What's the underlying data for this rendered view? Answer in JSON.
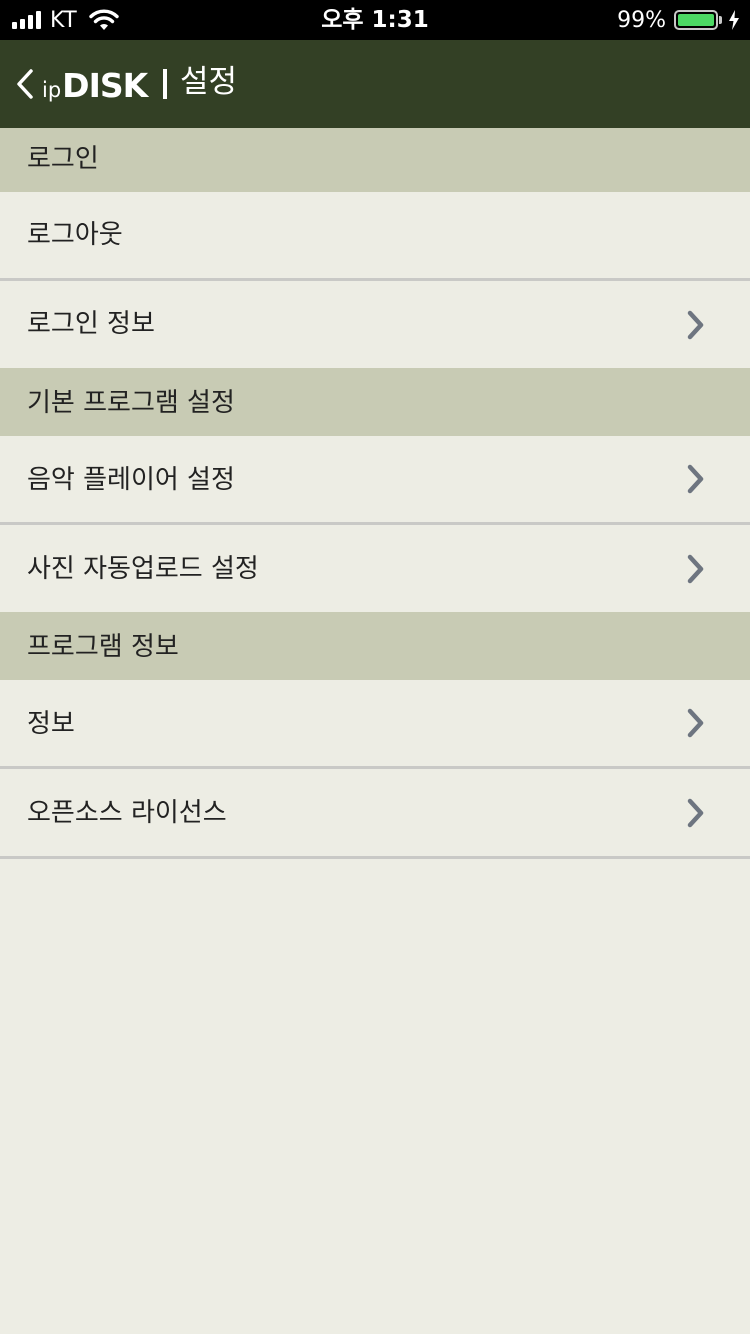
{
  "status_bar": {
    "carrier": "KT",
    "time": "오후 1:31",
    "battery_percent": "99%",
    "battery_level": 0.99,
    "battery_color": "#4cd964"
  },
  "nav": {
    "logo_ip": "ip",
    "logo_disk": "DISK",
    "title": "설정",
    "back_icon": "chevron-left-icon",
    "background": "#334025"
  },
  "sections": {
    "login": {
      "header": "로그인",
      "logout": "로그아웃",
      "login_info": "로그인 정보"
    },
    "default_programs": {
      "header": "기본 프로그램 설정",
      "music_player": "음악 플레이어 설정",
      "photo_upload": "사진 자동업로드 설정"
    },
    "program_info": {
      "header": "프로그램 정보",
      "info": "정보",
      "open_source": "오픈소스 라이선스"
    }
  },
  "colors": {
    "section_header_bg": "#c8cbb4",
    "row_bg": "#edede4",
    "chevron": "#6e7580"
  }
}
